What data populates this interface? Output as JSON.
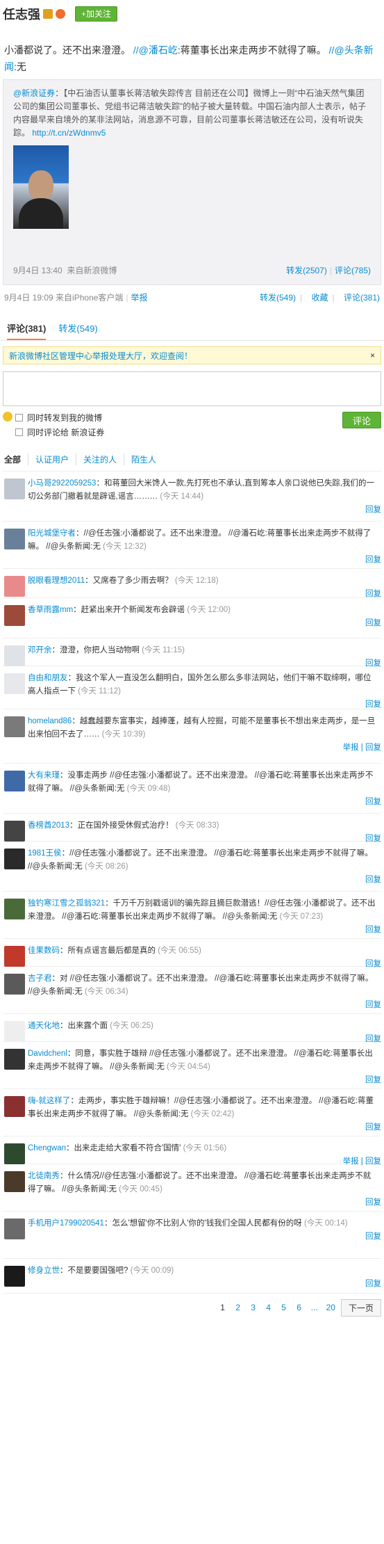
{
  "header": {
    "name": "任志强",
    "follow_label": "+加关注"
  },
  "main": {
    "text": "小潘都说了。还不出来澄澄。",
    "mention1": "//@潘石屹",
    "text2": ":蒋董事长出来走两步不就得了嘛。",
    "mention2": "//@头条新闻",
    "text3": ":无"
  },
  "quote": {
    "author": "@新浪证券",
    "body": "：【中石油否认董事长蒋洁敏失踪传言 目前还在公司】微博上一则“中石油天然气集团公司的集团公司董事长、党组书记蒋洁敏失踪”的帖子被大量转载。中国石油内部人士表示，帖子内容最早来自境外的某非法网站，消息源不可靠，目前公司董事长蒋洁敏还在公司，没有听说失踪。",
    "link": "http://t.cn/zWdnmv5",
    "date": "9月4日 13:40",
    "source": "来自新浪微博",
    "repost": "转发(2507)",
    "comment": "评论(785)"
  },
  "meta": {
    "time": "9月4日 19:09 来自iPhone客户端",
    "report": "举报",
    "repost": "转发(549)",
    "fav": "收藏",
    "comment": "评论(381)"
  },
  "tabs": {
    "comment": "评论(381)",
    "repost": "转发(549)"
  },
  "notice": {
    "text": "新浪微博社区管理中心举报处理大厅，欢迎查阅！",
    "close": "×"
  },
  "reply": {
    "opt1": "同时转发到我的微博",
    "opt2": "同时评论给 新浪证券",
    "send": "评论"
  },
  "filters": [
    "全部",
    "认证用户",
    "关注的人",
    "陌生人"
  ],
  "comments": [
    {
      "name": "小马哥2922059253",
      "text": "：和蒋董回大米馋人一款,先打死也不承认,直到筹本人亲口说他已失踪,我们的一切公务部门撤着就是辟谣,谣言………",
      "time": "(今天 14:44)",
      "op": "回复"
    },
    {
      "name": "阳光城堡守者",
      "text": "：//@任志强:小潘都说了。还不出来澄澄。 //@潘石屹:蒋董事长出来走两步不就得了嘛。 //@头条新闻:无",
      "time": "(今天 12:32)",
      "op": "回复"
    },
    {
      "name": "脱眼看理想2011",
      "text": "：又席卷了多少雨去啊？",
      "time": "(今天 12:18)",
      "op": "回复"
    },
    {
      "name": "香草雨露mm",
      "text": "：赶紧出来开个新闻发布会辟谣",
      "time": "(今天 12:00)",
      "op": "回复"
    },
    {
      "name": "邓开余",
      "text": "：澄澄，你把人当动物啊",
      "time": "(今天 11:15)",
      "op": "回复"
    },
    {
      "name": "自由和朋友",
      "text": "：我这个军人一直没怎么翻明白，国外怎么那么多非法网站，他们干嘛不取缔啊，哪位高人指点一下",
      "time": "(今天 11:12)",
      "op": "回复"
    },
    {
      "name": "homeland86",
      "text": "：越蠢越要东富事实，越捧蓬，越有人控掘，可能不是董事长不想出来走两步，是一旦出来怕回不去了……",
      "time": "(今天 10:39)",
      "op": "举报 | 回复"
    },
    {
      "name": "大有来瑾",
      "text": "：没事走两步 //@任志强:小潘都说了。还不出来澄澄。 //@潘石屹:蒋董事长出来走两步不就得了嘛。 //@头条新闻:无",
      "time": "(今天 09:48)",
      "op": "回复"
    },
    {
      "name": "香榜酋2013",
      "text": "：正在国外接受休假式治疗！",
      "time": "(今天 08:33)",
      "op": "回复"
    },
    {
      "name": "1981王侯",
      "text": "：//@任志强:小潘都说了。还不出来澄澄。 //@潘石屹:蒋董事长出来走两步不就得了嘛。 //@头条新闻:无",
      "time": "(今天 08:26)",
      "op": "回复"
    },
    {
      "name": "独钓寒江雪之孤翁321",
      "text": "：千万千万别戳谣训的骗先踪且摘巨款潜逃！//@任志强:小潘都说了。还不出来澄澄。 //@潘石屹:蒋董事长出来走两步不就得了嘛。 //@头条新闻:无",
      "time": "(今天 07:23)",
      "op": "回复"
    },
    {
      "name": "佳果数码",
      "text": "：所有点谣言最后都是真的",
      "time": "(今天 06:55)",
      "op": "回复"
    },
    {
      "name": "吉子君",
      "text": "：对 //@任志强:小潘都说了。还不出来澄澄。 //@潘石屹:蒋董事长出来走两步不就得了嘛。 //@头条新闻:无",
      "time": "(今天 06:34)",
      "op": "回复"
    },
    {
      "name": "通天化地",
      "text": "：出来露个面",
      "time": "(今天 06:25)",
      "op": "回复"
    },
    {
      "name": "Davidchenl",
      "text": "：同意，事实胜于雄辩 //@任志强:小潘都说了。还不出来澄澄。 //@潘石屹:蒋董事长出来走两步不就得了嘛。 //@头条新闻:无",
      "time": "(今天 04:54)",
      "op": "回复"
    },
    {
      "name": "嗨-就这样了",
      "text": "：走两步，事实胜于雄辩嘛！//@任志强:小潘都说了。还不出来澄澄。 //@潘石屹:蒋董事长出来走两步不就得了嘛。 //@头条新闻:无",
      "time": "(今天 02:42)",
      "op": "回复"
    },
    {
      "name": "Chengwan",
      "text": "：出来走走给大家看不符合'国情'",
      "time": "(今天 01:56)",
      "op": "举报 | 回复"
    },
    {
      "name": "北徒南秀",
      "text": "：什么情况//@任志强:小潘都说了。还不出来澄澄。 //@潘石屹:蒋董事长出来走两步不就得了嘛。 //@头条新闻:无",
      "time": "(今天 00:45)",
      "op": "回复"
    },
    {
      "name": "手机用户1799020541",
      "text": "：怎么'想留'你不比别人'你的'钱我们全国人民都有份的呀",
      "time": "(今天 00:14)",
      "op": "回复"
    },
    {
      "name": "修身立世",
      "text": "：不是要要国强吧?",
      "time": "(今天 00:09)",
      "op": "回复"
    }
  ],
  "pager": {
    "pages": [
      "1",
      "2",
      "3",
      "4",
      "5",
      "6",
      "...",
      "20"
    ],
    "next": "下一页"
  },
  "colors": {
    "link": "#0a8cd2",
    "accent": "#fa7d3c",
    "green": "#5fb336"
  }
}
